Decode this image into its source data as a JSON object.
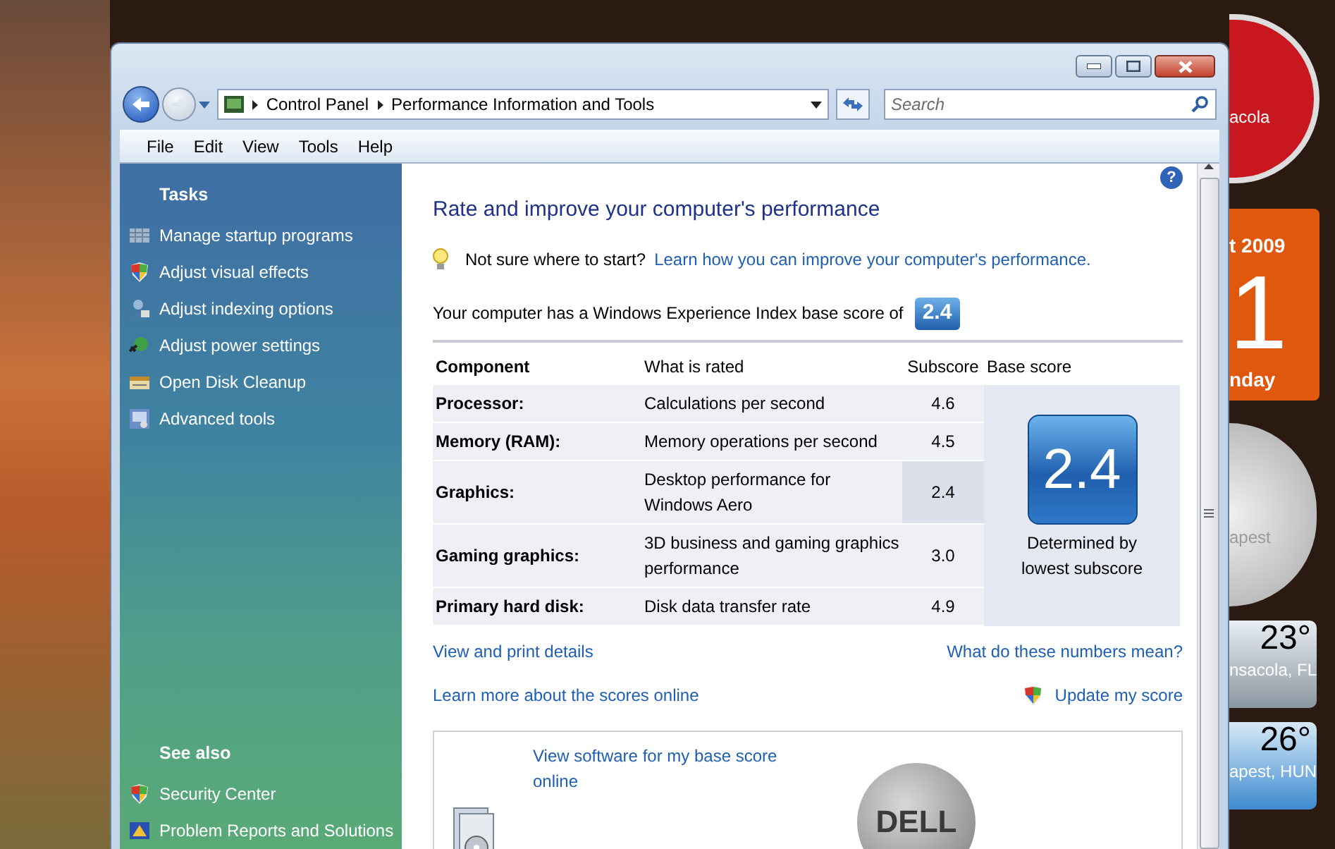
{
  "address_bar": {
    "breadcrumbs": [
      "Control Panel",
      "Performance Information and Tools"
    ]
  },
  "search": {
    "placeholder": "Search"
  },
  "menu": [
    "File",
    "Edit",
    "View",
    "Tools",
    "Help"
  ],
  "sidebar": {
    "tasks_heading": "Tasks",
    "tasks": [
      "Manage startup programs",
      "Adjust visual effects",
      "Adjust indexing options",
      "Adjust power settings",
      "Open Disk Cleanup",
      "Advanced tools"
    ],
    "see_also_heading": "See also",
    "see_also": [
      "Security Center",
      "Problem Reports and Solutions"
    ]
  },
  "main": {
    "help_button": "?",
    "title": "Rate and improve your computer's performance",
    "tip": {
      "text": "Not sure where to start?",
      "link": "Learn how you can improve your computer's performance."
    },
    "score_text": "Your computer has a Windows Experience Index base score of",
    "base_score": "2.4",
    "table": {
      "columns": [
        "Component",
        "What is rated",
        "Subscore",
        "Base score"
      ],
      "rows": [
        {
          "component": "Processor:",
          "rated": "Calculations per second",
          "subscore": "4.6",
          "lowest": false
        },
        {
          "component": "Memory (RAM):",
          "rated": "Memory operations per second",
          "subscore": "4.5",
          "lowest": false
        },
        {
          "component": "Graphics:",
          "rated": "Desktop performance for Windows Aero",
          "subscore": "2.4",
          "lowest": true
        },
        {
          "component": "Gaming graphics:",
          "rated": "3D business and gaming graphics performance",
          "subscore": "3.0",
          "lowest": false
        },
        {
          "component": "Primary hard disk:",
          "rated": "Disk data transfer rate",
          "subscore": "4.9",
          "lowest": false
        }
      ],
      "base_score": "2.4",
      "base_caption": "Determined by lowest subscore"
    },
    "links_left": [
      "View and print details",
      "Learn more about the scores online"
    ],
    "links_right": [
      "What do these numbers mean?",
      "Update my score"
    ],
    "software": {
      "link": "View software for my base score online",
      "logo": "DELL"
    }
  },
  "gadgets": {
    "clock_city": "acola",
    "calendar": {
      "month": "t 2009",
      "day": "1",
      "weekday": "nday"
    },
    "clock2_city": "apest",
    "weather": [
      {
        "temp": "23°",
        "city": "nsacola, FL"
      },
      {
        "temp": "26°",
        "city": "apest, HUN"
      }
    ]
  }
}
